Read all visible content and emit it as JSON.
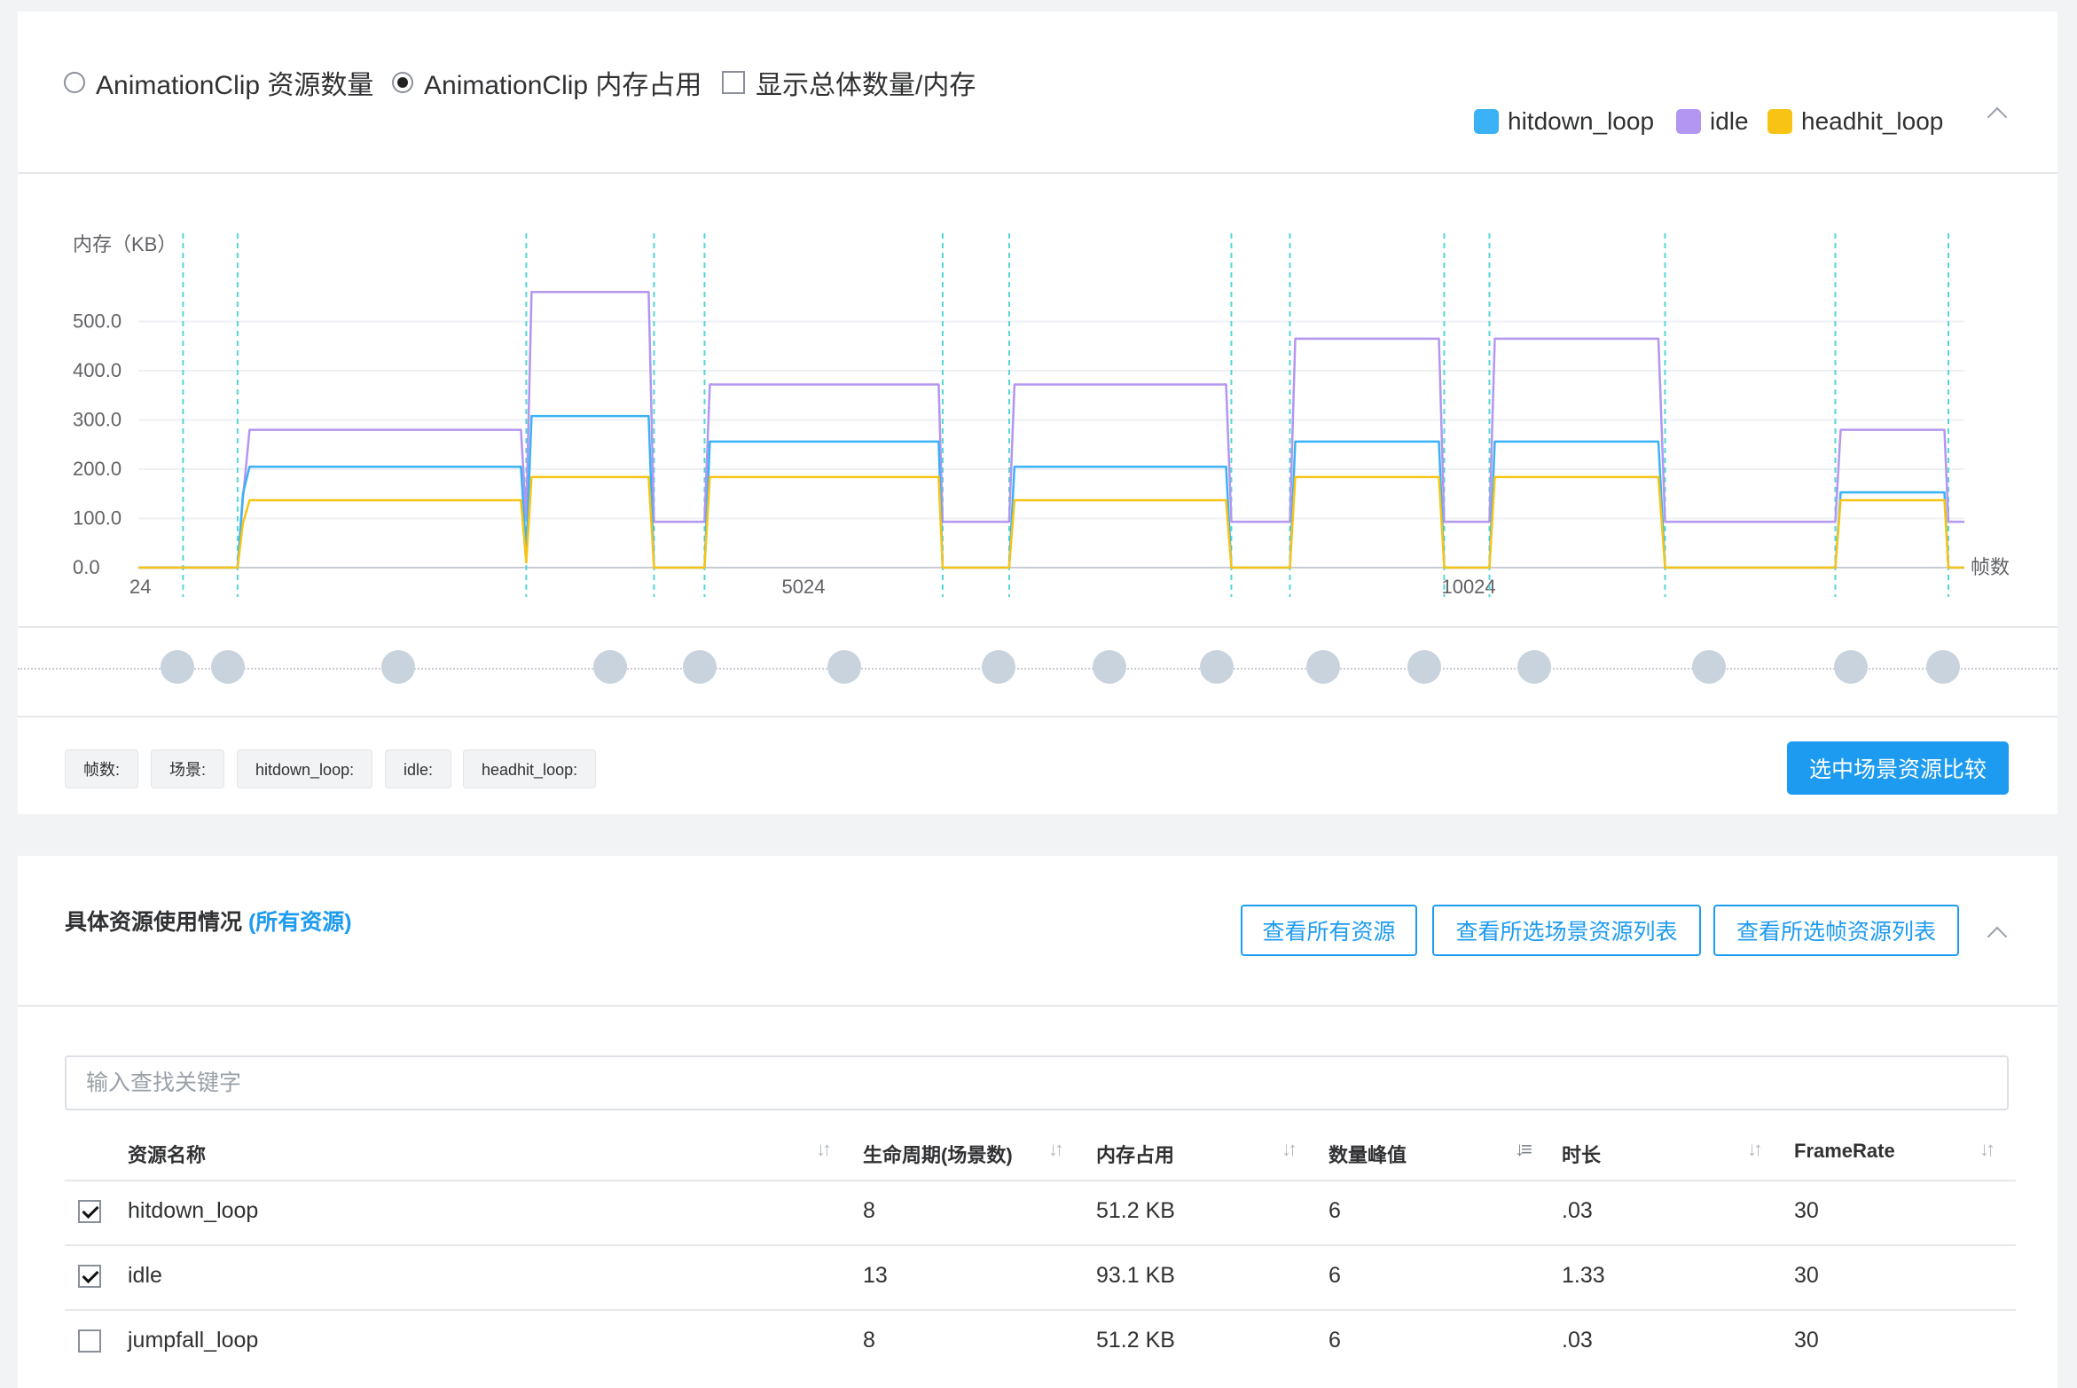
{
  "options": {
    "radio_count": "AnimationClip 资源数量",
    "radio_memory": "AnimationClip 内存占用",
    "checkbox_total": "显示总体数量/内存",
    "selected": "memory"
  },
  "legend": [
    {
      "name": "hitdown_loop",
      "color": "#3bb2f5"
    },
    {
      "name": "idle",
      "color": "#b296f0"
    },
    {
      "name": "headhit_loop",
      "color": "#f7c415"
    }
  ],
  "chart_data": {
    "type": "line",
    "ylabel": "内存（KB）",
    "xlabel": "帧数",
    "ylim": [
      0,
      560
    ],
    "yticks": [
      "0.0",
      "100.0",
      "200.0",
      "300.0",
      "400.0",
      "500.0"
    ],
    "xlim": [
      24,
      13750
    ],
    "xticks": [
      {
        "value": 24,
        "label": "24"
      },
      {
        "value": 5024,
        "label": "5024"
      },
      {
        "value": 10024,
        "label": "10024"
      }
    ],
    "markers": [
      360,
      770,
      2940,
      3900,
      4280,
      6070,
      6570,
      8240,
      8680,
      9840,
      10180,
      11500,
      12780,
      13630
    ],
    "series": [
      {
        "name": "idle",
        "color": "#b296f0",
        "points": [
          [
            24,
            0
          ],
          [
            770,
            0
          ],
          [
            810,
            140
          ],
          [
            860,
            280
          ],
          [
            2900,
            280
          ],
          [
            2940,
            100
          ],
          [
            2980,
            560
          ],
          [
            3860,
            560
          ],
          [
            3900,
            93
          ],
          [
            4280,
            93
          ],
          [
            4320,
            372
          ],
          [
            6040,
            372
          ],
          [
            6070,
            93
          ],
          [
            6570,
            93
          ],
          [
            6610,
            372
          ],
          [
            8200,
            372
          ],
          [
            8240,
            93
          ],
          [
            8680,
            93
          ],
          [
            8720,
            465
          ],
          [
            9800,
            465
          ],
          [
            9840,
            93
          ],
          [
            10180,
            93
          ],
          [
            10220,
            465
          ],
          [
            11450,
            465
          ],
          [
            11500,
            93
          ],
          [
            12780,
            93
          ],
          [
            12820,
            280
          ],
          [
            13600,
            280
          ],
          [
            13630,
            93
          ],
          [
            13750,
            93
          ]
        ]
      },
      {
        "name": "hitdown_loop",
        "color": "#3bb2f5",
        "points": [
          [
            24,
            0
          ],
          [
            770,
            0
          ],
          [
            810,
            150
          ],
          [
            860,
            205
          ],
          [
            2900,
            205
          ],
          [
            2940,
            30
          ],
          [
            2980,
            308
          ],
          [
            3860,
            308
          ],
          [
            3900,
            0
          ],
          [
            4280,
            0
          ],
          [
            4320,
            256
          ],
          [
            6040,
            256
          ],
          [
            6070,
            0
          ],
          [
            6570,
            0
          ],
          [
            6610,
            205
          ],
          [
            8200,
            205
          ],
          [
            8240,
            0
          ],
          [
            8680,
            0
          ],
          [
            8720,
            256
          ],
          [
            9800,
            256
          ],
          [
            9840,
            0
          ],
          [
            10180,
            0
          ],
          [
            10220,
            256
          ],
          [
            11450,
            256
          ],
          [
            11500,
            0
          ],
          [
            12780,
            0
          ],
          [
            12820,
            153
          ],
          [
            13600,
            153
          ],
          [
            13630,
            0
          ],
          [
            13750,
            0
          ]
        ]
      },
      {
        "name": "headhit_loop",
        "color": "#f7c415",
        "points": [
          [
            24,
            0
          ],
          [
            770,
            0
          ],
          [
            810,
            90
          ],
          [
            860,
            137
          ],
          [
            2900,
            137
          ],
          [
            2940,
            10
          ],
          [
            2980,
            184
          ],
          [
            3860,
            184
          ],
          [
            3900,
            0
          ],
          [
            4280,
            0
          ],
          [
            4320,
            184
          ],
          [
            6040,
            184
          ],
          [
            6070,
            0
          ],
          [
            6570,
            0
          ],
          [
            6610,
            137
          ],
          [
            8200,
            137
          ],
          [
            8240,
            0
          ],
          [
            8680,
            0
          ],
          [
            8720,
            184
          ],
          [
            9800,
            184
          ],
          [
            9840,
            0
          ],
          [
            10180,
            0
          ],
          [
            10220,
            184
          ],
          [
            11450,
            184
          ],
          [
            11500,
            0
          ],
          [
            12780,
            0
          ],
          [
            12820,
            137
          ],
          [
            13600,
            137
          ],
          [
            13630,
            0
          ],
          [
            13750,
            0
          ]
        ]
      }
    ]
  },
  "timeline_dots": 15,
  "info_tags": [
    "帧数:",
    "场景:",
    "hitdown_loop:",
    "idle:",
    "headhit_loop:"
  ],
  "compare_button": "选中场景资源比较",
  "section": {
    "title": "具体资源使用情况",
    "highlight": "(所有资源)",
    "btn_all": "查看所有资源",
    "btn_scene": "查看所选场景资源列表",
    "btn_frame": "查看所选帧资源列表"
  },
  "search": {
    "placeholder": "输入查找关键字",
    "value": ""
  },
  "table": {
    "headers": [
      "资源名称",
      "生命周期(场景数)",
      "内存占用",
      "数量峰值",
      "时长",
      "FrameRate"
    ],
    "rows": [
      {
        "checked": true,
        "cells": [
          "hitdown_loop",
          "8",
          "51.2 KB",
          "6",
          ".03",
          "30"
        ]
      },
      {
        "checked": true,
        "cells": [
          "idle",
          "13",
          "93.1 KB",
          "6",
          "1.33",
          "30"
        ]
      },
      {
        "checked": false,
        "cells": [
          "jumpfall_loop",
          "8",
          "51.2 KB",
          "6",
          ".03",
          "30"
        ]
      }
    ]
  }
}
